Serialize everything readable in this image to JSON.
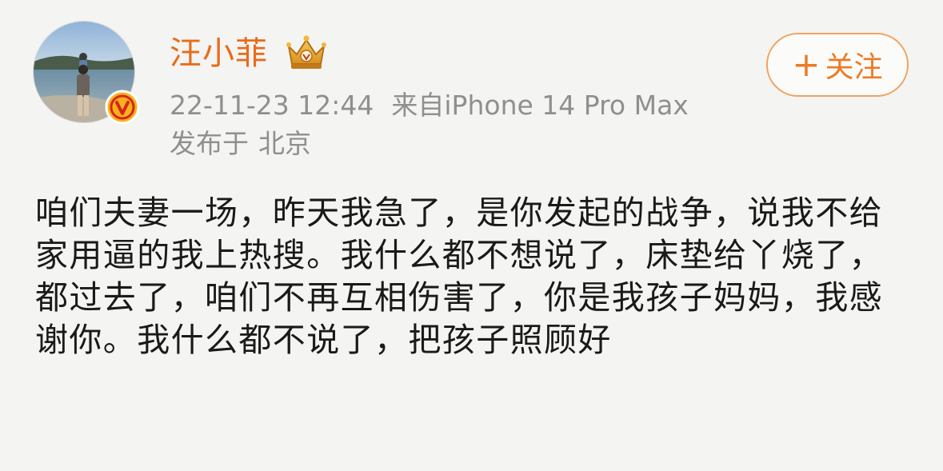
{
  "author": {
    "name": "汪小菲",
    "avatar_icon": "user-avatar-photo",
    "verified_icon": "verified-v-badge",
    "vip_icon": "vip-crown-icon"
  },
  "meta": {
    "timestamp": "22-11-23 12:44",
    "source": "来自iPhone 14 Pro Max",
    "location_prefix": "发布于",
    "location": "北京"
  },
  "follow_button": {
    "icon": "+",
    "label": "关注"
  },
  "post": {
    "text": "咱们夫妻一场，昨天我急了，是你发起的战争，说我不给家用逼的我上热搜。我什么都不想说了，床垫给丫烧了，都过去了，咱们不再互相伤害了，你是我孩子妈妈，我感谢你。我什么都不说了，把孩子照顾好"
  },
  "colors": {
    "accent": "#e86c1a",
    "meta_gray": "#8f8f8f",
    "background": "#f4f4f2",
    "verified": "#e8a317"
  }
}
